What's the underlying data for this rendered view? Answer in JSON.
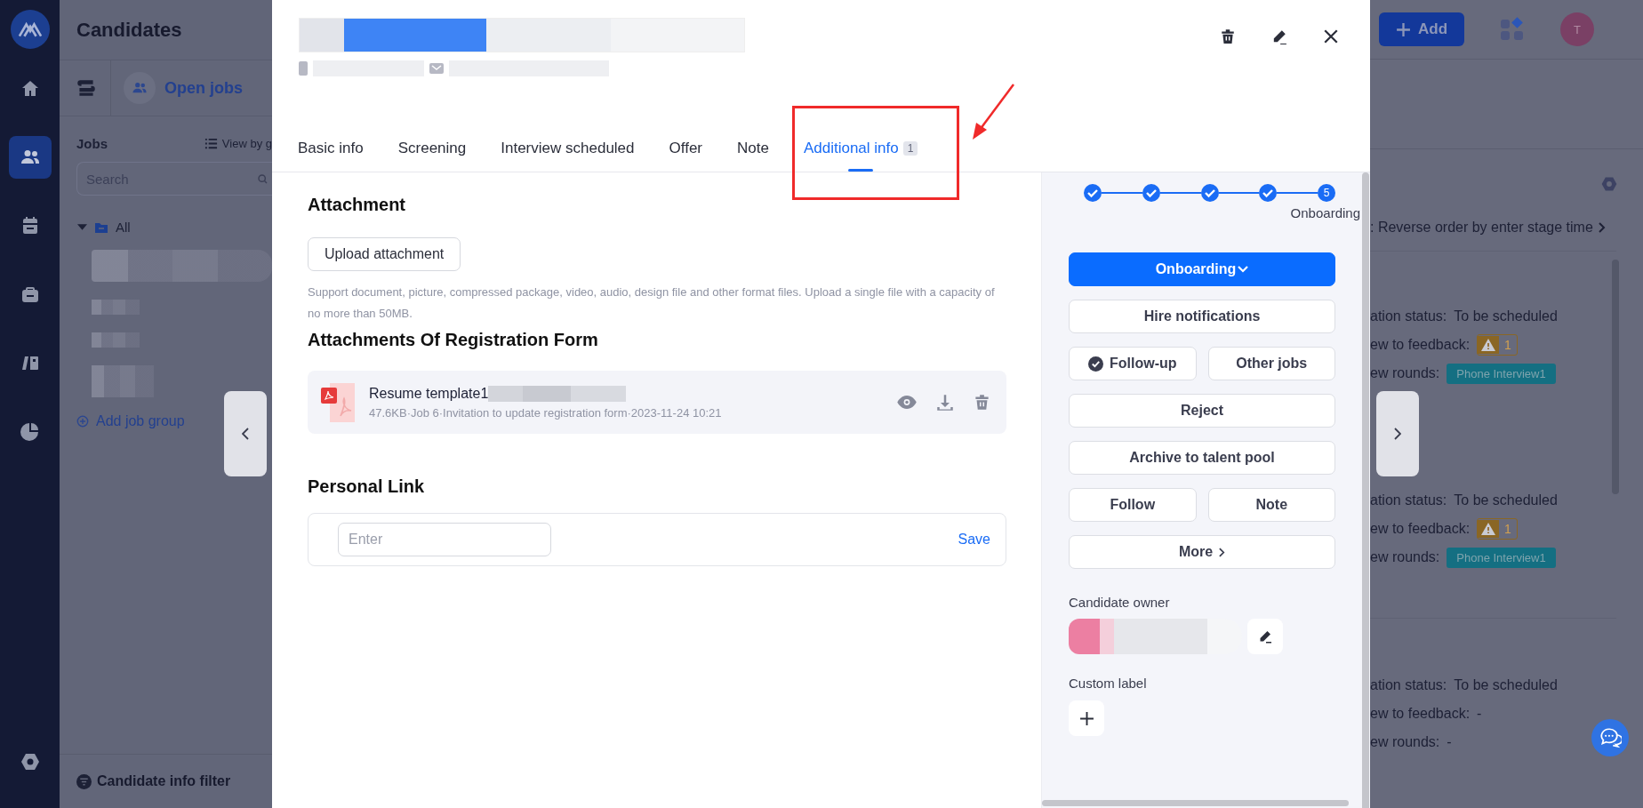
{
  "nav": {
    "items": [
      {
        "kind": "home",
        "selected": false
      },
      {
        "kind": "people",
        "selected": true
      },
      {
        "kind": "calendar",
        "selected": false
      },
      {
        "kind": "briefcase",
        "selected": false
      },
      {
        "kind": "cards",
        "selected": false
      },
      {
        "kind": "chart",
        "selected": false
      }
    ]
  },
  "page": {
    "title": "Candidates",
    "view": "Open jobs",
    "jobs_label": "Jobs",
    "view_by": "View by g",
    "search": {
      "placeholder": "Search"
    },
    "tree": {
      "label": "All",
      "expanded": true
    },
    "add_group": "Add job group",
    "filter": "Candidate info filter"
  },
  "topbar": {
    "add": "Add",
    "avatar": "T"
  },
  "list": {
    "sort": ": Reverse order by enter stage time",
    "rows": [
      {
        "status_label": "ation status:",
        "status": "To be scheduled",
        "feedback_label": "ew to feedback:",
        "feedback": {
          "kind": "warning",
          "text": "1"
        },
        "rounds_label": "ew rounds:",
        "rounds": {
          "kind": "tag",
          "text": "Phone Interview1"
        }
      },
      {
        "status_label": "ation status:",
        "status": "To be scheduled",
        "feedback_label": "ew to feedback:",
        "feedback": {
          "kind": "warning",
          "text": "1"
        },
        "rounds_label": "ew rounds:",
        "rounds": {
          "kind": "tag",
          "text": "Phone Interview1"
        }
      },
      {
        "status_label": "ation status:",
        "status": "To be scheduled",
        "feedback_label": "ew to feedback:",
        "feedback": {
          "kind": "text",
          "text": "-"
        },
        "rounds_label": "ew rounds:",
        "rounds": {
          "kind": "text",
          "text": "-"
        }
      }
    ]
  },
  "modal": {
    "tabs": [
      {
        "label": "Basic info",
        "selected": false
      },
      {
        "label": "Screening",
        "selected": false
      },
      {
        "label": "Interview scheduled",
        "selected": false
      },
      {
        "label": "Offer",
        "selected": false
      },
      {
        "label": "Note",
        "selected": false
      },
      {
        "label": "Additional info",
        "badge": "1",
        "selected": true
      }
    ],
    "attachment": {
      "title": "Attachment",
      "upload": "Upload attachment",
      "hint": "Support document, picture, compressed package, video, audio, design file and other format files. Upload a single file with a capacity of no more than 50MB."
    },
    "registration": {
      "title": "Attachments Of Registration Form",
      "files": [
        {
          "name": "Resume template1",
          "meta": "47.6KB·Job 6·Invitation to update registration form·2023-11-24 10:21"
        }
      ]
    },
    "personal_link": {
      "title": "Personal Link",
      "placeholder": "Enter",
      "save": "Save"
    },
    "stages": [
      {
        "done": true
      },
      {
        "done": true
      },
      {
        "done": true
      },
      {
        "done": true
      },
      {
        "done": false,
        "number": "5"
      }
    ],
    "stage_label": "Onboarding",
    "actions": [
      {
        "kind": "dropdown",
        "label": "Onboarding",
        "checked": false
      },
      {
        "kind": "full",
        "label": "Hire notifications",
        "checked": false
      },
      {
        "kind": "half",
        "label": "Follow-up",
        "checked": true
      },
      {
        "kind": "half",
        "label": "Other jobs",
        "checked": false
      },
      {
        "kind": "full",
        "label": "Reject",
        "checked": false
      },
      {
        "kind": "full",
        "label": "Archive to talent pool",
        "checked": false
      },
      {
        "kind": "half",
        "label": "Follow",
        "checked": false
      },
      {
        "kind": "half",
        "label": "Note",
        "checked": false
      },
      {
        "kind": "more",
        "label": "More",
        "checked": false
      }
    ],
    "owner_label": "Candidate owner",
    "custom_label": "Custom label"
  }
}
